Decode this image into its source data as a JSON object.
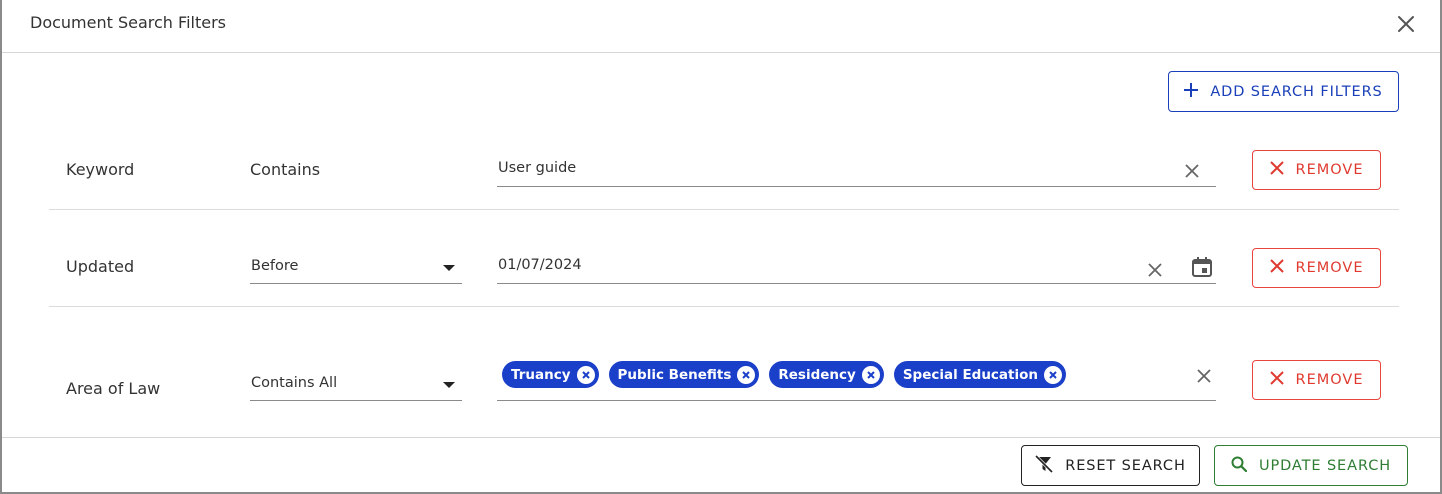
{
  "dialog": {
    "title": "Document Search Filters"
  },
  "toolbar": {
    "add_label": "ADD SEARCH FILTERS"
  },
  "filters": [
    {
      "label": "Keyword",
      "operator": "Contains",
      "value": "User guide",
      "remove_label": "REMOVE"
    },
    {
      "label": "Updated",
      "operator": "Before",
      "value": "01/07/2024",
      "remove_label": "REMOVE"
    },
    {
      "label": "Area of Law",
      "operator": "Contains All",
      "chips": [
        "Truancy",
        "Public Benefits",
        "Residency",
        "Special Education"
      ],
      "remove_label": "REMOVE"
    }
  ],
  "footer": {
    "reset_label": "RESET SEARCH",
    "update_label": "UPDATE SEARCH"
  },
  "colors": {
    "primary": "#1a3fc8",
    "danger": "#e03a30",
    "success": "#2e7d32"
  }
}
